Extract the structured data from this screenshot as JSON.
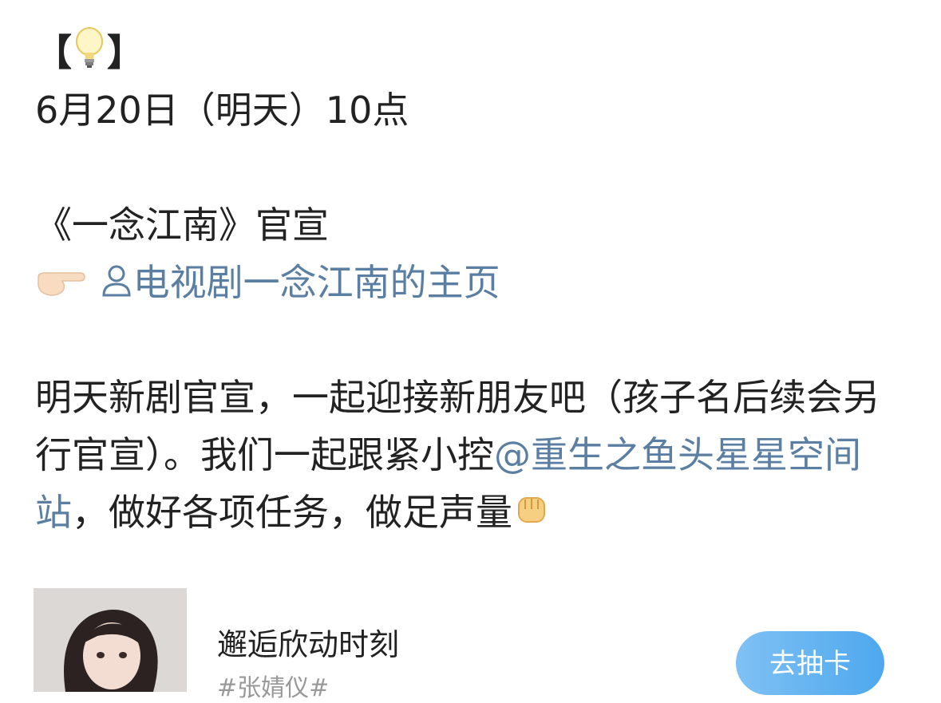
{
  "post": {
    "bracket_open": "【",
    "bracket_close": "】",
    "bulb_icon": "lightbulb-icon",
    "date_line": "6月20日（明天）10点",
    "title_line": "《一念江南》官宣",
    "pointer_icon": "pointing-right-hand-icon",
    "user_icon": "user-icon",
    "profile_link": "电视剧一念江南的主页",
    "body_1": "明天新剧官宣，一起迎接新朋友吧（孩子名后续会另行官宣）。我们一起跟紧小控",
    "mention": "@重生之鱼头星星空间站",
    "body_2": "，做好各项任务，做足声量",
    "fist_icon": "raised-fist-icon"
  },
  "card": {
    "title": "邂逅欣动时刻",
    "subtitle": "#张婧仪#",
    "button": "去抽卡"
  },
  "colors": {
    "link": "#5b7ea3",
    "button": "#4ea8ee"
  }
}
